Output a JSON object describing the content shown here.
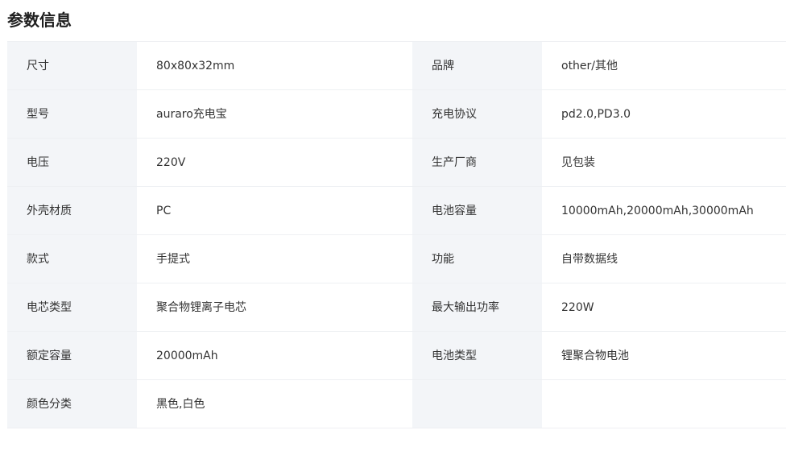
{
  "section": {
    "title": "参数信息"
  },
  "params": [
    {
      "left_label": "尺寸",
      "left_value": "80x80x32mm",
      "right_label": "品牌",
      "right_value": "other/其他"
    },
    {
      "left_label": "型号",
      "left_value": "auraro充电宝",
      "right_label": "充电协议",
      "right_value": "pd2.0,PD3.0"
    },
    {
      "left_label": "电压",
      "left_value": "220V",
      "right_label": "生产厂商",
      "right_value": "见包装"
    },
    {
      "left_label": "外壳材质",
      "left_value": "PC",
      "right_label": "电池容量",
      "right_value": "10000mAh,20000mAh,30000mAh"
    },
    {
      "left_label": "款式",
      "left_value": "手提式",
      "right_label": "功能",
      "right_value": "自带数据线"
    },
    {
      "left_label": "电芯类型",
      "left_value": "聚合物锂离子电芯",
      "right_label": "最大输出功率",
      "right_value": "220W"
    },
    {
      "left_label": "额定容量",
      "left_value": "20000mAh",
      "right_label": "电池类型",
      "right_value": "锂聚合物电池"
    },
    {
      "left_label": "颜色分类",
      "left_value": "黑色,白色",
      "right_label": "",
      "right_value": ""
    }
  ]
}
